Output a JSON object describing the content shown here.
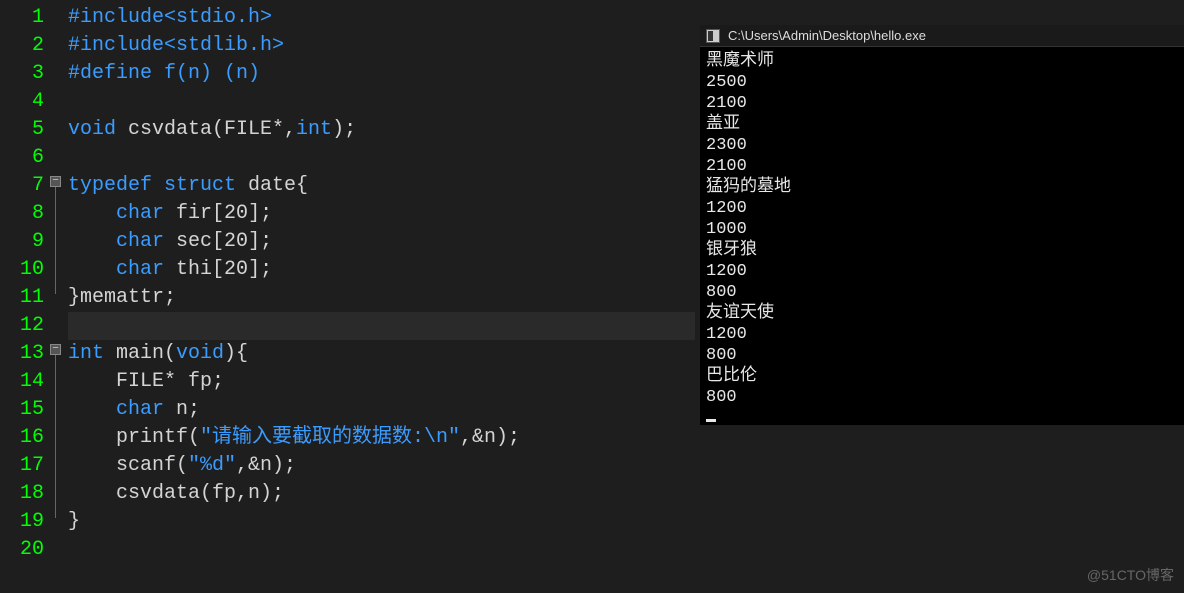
{
  "editor": {
    "lines": [
      {
        "n": 1,
        "tokens": [
          {
            "t": "#include",
            "c": "tok-preproc"
          },
          {
            "t": "<stdio.h>",
            "c": "tok-preproc"
          }
        ]
      },
      {
        "n": 2,
        "tokens": [
          {
            "t": "#include",
            "c": "tok-preproc"
          },
          {
            "t": "<stdlib.h>",
            "c": "tok-preproc"
          }
        ]
      },
      {
        "n": 3,
        "tokens": [
          {
            "t": "#define",
            "c": "tok-preproc"
          },
          {
            "t": " ",
            "c": "tok-plain"
          },
          {
            "t": "f(n) (n)",
            "c": "tok-preproc"
          }
        ]
      },
      {
        "n": 4,
        "tokens": []
      },
      {
        "n": 5,
        "tokens": [
          {
            "t": "void",
            "c": "tok-keyword"
          },
          {
            "t": " csvdata(FILE*,",
            "c": "tok-plain"
          },
          {
            "t": "int",
            "c": "tok-keyword"
          },
          {
            "t": ");",
            "c": "tok-plain"
          }
        ]
      },
      {
        "n": 6,
        "tokens": []
      },
      {
        "n": 7,
        "fold": true,
        "tokens": [
          {
            "t": "typedef",
            "c": "tok-keyword"
          },
          {
            "t": " ",
            "c": "tok-plain"
          },
          {
            "t": "struct",
            "c": "tok-keyword"
          },
          {
            "t": " date{",
            "c": "tok-plain"
          }
        ]
      },
      {
        "n": 8,
        "tokens": [
          {
            "t": "    ",
            "c": "tok-plain"
          },
          {
            "t": "char",
            "c": "tok-keyword"
          },
          {
            "t": " fir[",
            "c": "tok-plain"
          },
          {
            "t": "20",
            "c": "tok-num"
          },
          {
            "t": "];",
            "c": "tok-plain"
          }
        ]
      },
      {
        "n": 9,
        "tokens": [
          {
            "t": "    ",
            "c": "tok-plain"
          },
          {
            "t": "char",
            "c": "tok-keyword"
          },
          {
            "t": " sec[",
            "c": "tok-plain"
          },
          {
            "t": "20",
            "c": "tok-num"
          },
          {
            "t": "];",
            "c": "tok-plain"
          }
        ]
      },
      {
        "n": 10,
        "tokens": [
          {
            "t": "    ",
            "c": "tok-plain"
          },
          {
            "t": "char",
            "c": "tok-keyword"
          },
          {
            "t": " thi[",
            "c": "tok-plain"
          },
          {
            "t": "20",
            "c": "tok-num"
          },
          {
            "t": "];",
            "c": "tok-plain"
          }
        ]
      },
      {
        "n": 11,
        "tokens": [
          {
            "t": "}memattr;",
            "c": "tok-plain"
          }
        ]
      },
      {
        "n": 12,
        "current": true,
        "tokens": []
      },
      {
        "n": 13,
        "fold": true,
        "tokens": [
          {
            "t": "int",
            "c": "tok-keyword"
          },
          {
            "t": " main(",
            "c": "tok-plain"
          },
          {
            "t": "void",
            "c": "tok-keyword"
          },
          {
            "t": "){",
            "c": "tok-plain"
          }
        ]
      },
      {
        "n": 14,
        "tokens": [
          {
            "t": "    FILE* fp;",
            "c": "tok-plain"
          }
        ]
      },
      {
        "n": 15,
        "tokens": [
          {
            "t": "    ",
            "c": "tok-plain"
          },
          {
            "t": "char",
            "c": "tok-keyword"
          },
          {
            "t": " n;",
            "c": "tok-plain"
          }
        ]
      },
      {
        "n": 16,
        "tokens": [
          {
            "t": "    printf(",
            "c": "tok-plain"
          },
          {
            "t": "\"请输入要截取的数据数:\\n\"",
            "c": "tok-string"
          },
          {
            "t": ",&n);",
            "c": "tok-plain"
          }
        ]
      },
      {
        "n": 17,
        "tokens": [
          {
            "t": "    scanf(",
            "c": "tok-plain"
          },
          {
            "t": "\"%d\"",
            "c": "tok-string"
          },
          {
            "t": ",&n);",
            "c": "tok-plain"
          }
        ]
      },
      {
        "n": 18,
        "tokens": [
          {
            "t": "    csvdata(fp,n);",
            "c": "tok-plain"
          }
        ]
      },
      {
        "n": 19,
        "tokens": [
          {
            "t": "}",
            "c": "tok-plain"
          }
        ]
      },
      {
        "n": 20,
        "tokens": []
      }
    ]
  },
  "console": {
    "title": "C:\\Users\\Admin\\Desktop\\hello.exe",
    "output": [
      "黑魔术师",
      "2500",
      "2100",
      "盖亚",
      "2300",
      "2100",
      "猛犸的墓地",
      "1200",
      "1000",
      "银牙狼",
      "1200",
      "800",
      "友谊天使",
      "1200",
      "800",
      "巴比伦",
      "800"
    ]
  },
  "watermark": "@51CTO博客"
}
